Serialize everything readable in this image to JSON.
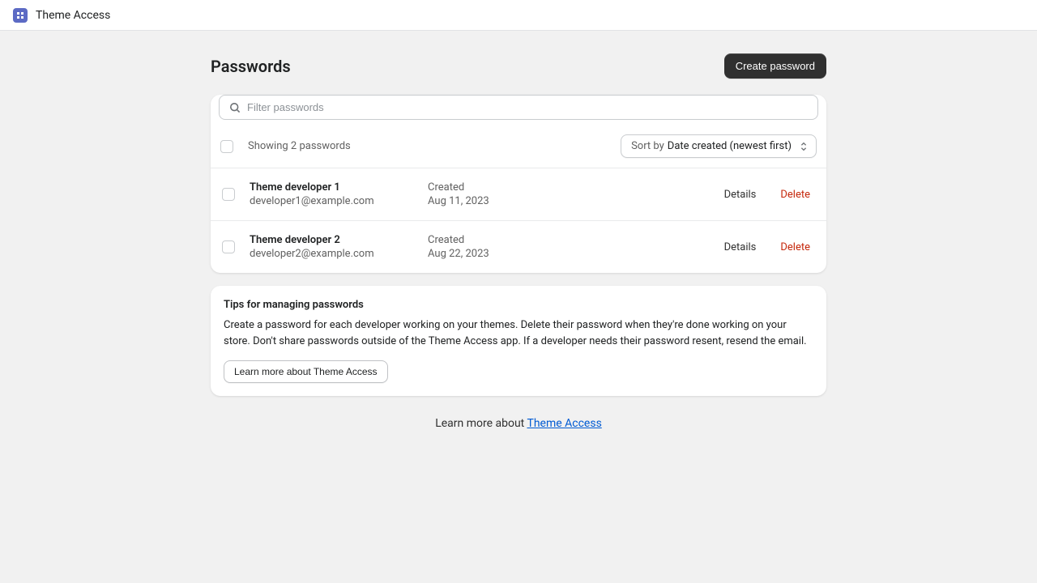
{
  "app": {
    "name": "Theme Access"
  },
  "page": {
    "title": "Passwords",
    "create_button": "Create password"
  },
  "search": {
    "placeholder": "Filter passwords"
  },
  "list": {
    "count_text": "Showing 2 passwords",
    "sort_label": "Sort by",
    "sort_value": "Date created (newest first)",
    "rows": [
      {
        "name": "Theme developer 1",
        "email": "developer1@example.com",
        "created_label": "Created",
        "created_date": "Aug 11, 2023",
        "details": "Details",
        "delete": "Delete"
      },
      {
        "name": "Theme developer 2",
        "email": "developer2@example.com",
        "created_label": "Created",
        "created_date": "Aug 22, 2023",
        "details": "Details",
        "delete": "Delete"
      }
    ]
  },
  "tips": {
    "title": "Tips for managing passwords",
    "body": "Create a password for each developer working on your themes. Delete their password when they're done working on your store. Don't share passwords outside of the Theme Access app. If a developer needs their password resent, resend the email.",
    "learn_button": "Learn more about Theme Access"
  },
  "footer": {
    "prefix": "Learn more about ",
    "link": "Theme Access"
  }
}
